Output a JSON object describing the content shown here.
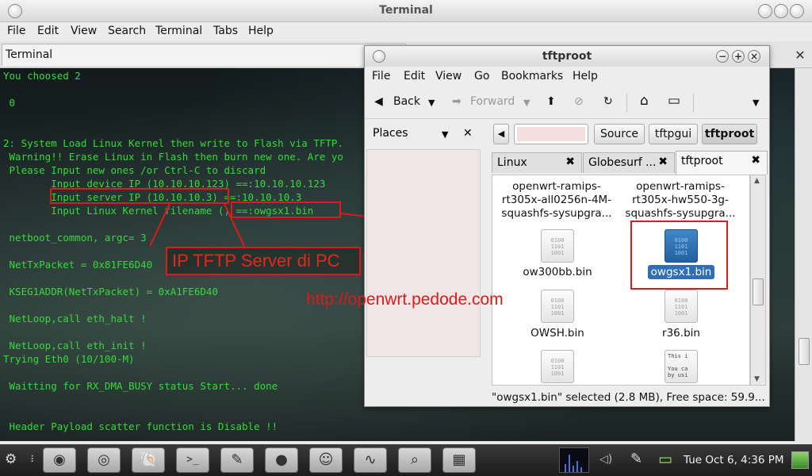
{
  "terminal": {
    "title": "Terminal",
    "menu": [
      "File",
      "Edit",
      "View",
      "Search",
      "Terminal",
      "Tabs",
      "Help"
    ],
    "tab_label": "Terminal",
    "close_glyph": "✕",
    "lines": [
      "You choosed 2",
      " 0",
      "2: System Load Linux Kernel then write to Flash via TFTP.",
      " Warning!! Erase Linux in Flash then burn new one. Are yo",
      " Please Input new ones /or Ctrl-C to discard",
      "        Input device IP (10.10.10.123) ==:10.10.10.123",
      "        Input server IP (10.10.10.3) ==:10.10.10.3",
      "        Input Linux Kernel filename () ==:owgsx1.bin",
      " netboot_common, argc= 3",
      " NetTxPacket = 0x81FE6D40",
      " KSEG1ADDR(NetTxPacket) = 0xA1FE6D40",
      " NetLoop,call eth_halt !",
      " NetLoop,call eth_init !",
      "Trying Eth0 (10/100-M)",
      " Waitting for RX_DMA_BUSY status Start... done",
      " Header Payload scatter function is Disable !!"
    ]
  },
  "filemanager": {
    "title": "tftproot",
    "menu": [
      "File",
      "Edit",
      "View",
      "Go",
      "Bookmarks",
      "Help"
    ],
    "toolbar": {
      "back": "Back",
      "forward": "Forward",
      "back_icon": "◀",
      "forward_icon": "➡",
      "dropdown_icon": "▼",
      "up_icon": "⬆",
      "stop_icon": "⊘",
      "reload_icon": "↻",
      "home_icon": "⌂",
      "computer_icon": "▭"
    },
    "window_buttons": [
      "−",
      "+",
      "×"
    ],
    "places_label": "Places",
    "places_dropdown": "▼",
    "places_close": "✕",
    "path_left_icon": "◀",
    "path_buttons": [
      "Source",
      "tftpgui",
      "tftproot"
    ],
    "tabs": [
      {
        "label": "Linux",
        "close": "✖"
      },
      {
        "label": "Globesurf ...",
        "close": "✖"
      },
      {
        "label": "tftproot",
        "close": "✖"
      }
    ],
    "files": {
      "top_left": [
        "openwrt-ramips-",
        "rt305x-all0256n-4M-",
        "squashfs-sysupgra..."
      ],
      "top_right": [
        "openwrt-ramips-",
        "rt305x-hw550-3g-",
        "squashfs-sysupgra..."
      ],
      "ow300bb": "ow300bb.bin",
      "owgsx1": "owgsx1.bin",
      "owsh": "OWSH.bin",
      "r36": "r36.bin",
      "txt_preview": [
        "This i",
        "",
        "You ca",
        "by usi"
      ]
    },
    "bin_glyph": [
      "0100",
      "1101",
      "1001"
    ],
    "status": "\"owgsx1.bin\" selected (2.8 MB), Free space: 59.9..."
  },
  "annotations": {
    "label": "IP TFTP Server di PC",
    "watermark": "http://openwrt.pedode.com"
  },
  "taskbar": {
    "clock": "Tue Oct  6,  4:36 PM",
    "apps": [
      "gear-icon",
      "eye-icon",
      "chrome-icon",
      "shell-icon",
      "terminal-icon",
      "notepad-icon",
      "camera-icon",
      "chat-icon",
      "monitor-icon",
      "inspect-icon",
      "drive-icon"
    ],
    "app_glyphs": [
      "⚙",
      "◉",
      "◎",
      "🐚",
      ">_",
      "✎",
      "●",
      "☺",
      "∿",
      "⌕",
      "▦"
    ],
    "volume_icon": "◁)",
    "pen_icon": "✎",
    "battery_icon": "▭",
    "grip": "⠇"
  }
}
